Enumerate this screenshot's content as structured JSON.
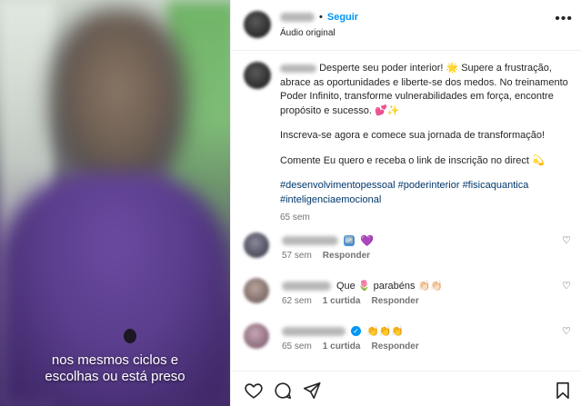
{
  "video": {
    "caption_line1": "nos mesmos ciclos e",
    "caption_line2": "escolhas ou está preso"
  },
  "header": {
    "username": "",
    "separator": "•",
    "follow_label": "Seguir",
    "subtitle": "Áudio original",
    "more_icon": "more-horizontal-icon"
  },
  "post": {
    "username": "",
    "paragraph1": "Desperte seu poder interior! 🌟 Supere a frustração, abrace as oportunidades e liberte-se dos medos. No treinamento Poder Infinito, transforme vulnerabilidades em força, encontre propósito e sucesso. 💕✨",
    "paragraph2": "Inscreva-se agora e comece sua jornada de transformação!",
    "paragraph3": "Comente Eu quero e receba o link de inscrição no direct 💫",
    "hashtags_line1": "#desenvolvimentopessoal #poderinterior #fisicaquantica",
    "hashtags_line2": "#inteligenciaemocional",
    "time": "65 sem"
  },
  "comments": [
    {
      "username": "",
      "text_suffix": "💜",
      "badge": "🆙",
      "time": "57 sem",
      "likes": "",
      "reply_label": "Responder"
    },
    {
      "username": "",
      "text": "Que 🌷 parabéns 👏🏻👏🏻",
      "time": "62 sem",
      "likes": "1 curtida",
      "reply_label": "Responder"
    },
    {
      "username": "",
      "text": "👏👏👏",
      "time": "65 sem",
      "likes": "1 curtida",
      "reply_label": "Responder"
    }
  ],
  "actions": {
    "like_icon": "heart-outline-icon",
    "comment_icon": "comment-bubble-icon",
    "share_icon": "paper-plane-icon",
    "save_icon": "bookmark-icon"
  },
  "colors": {
    "accent": "#0095f6",
    "text": "#262626",
    "muted": "#737373",
    "hashtag": "#00376b"
  }
}
